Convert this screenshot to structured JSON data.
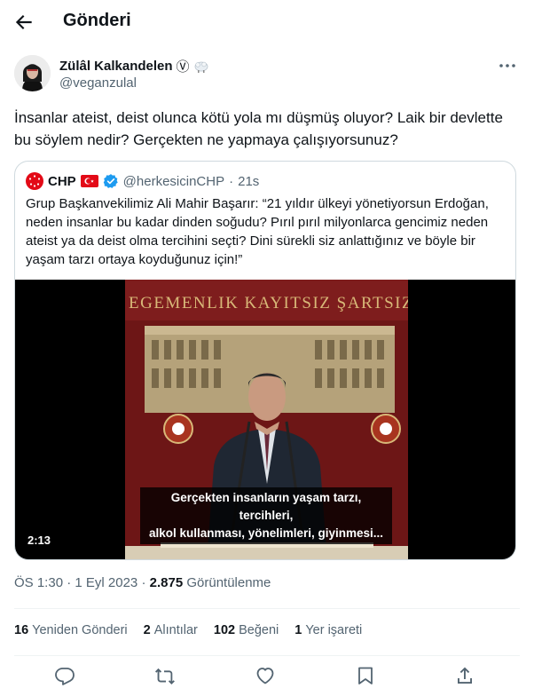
{
  "header": {
    "title": "Gönderi"
  },
  "author": {
    "name": "Zülâl Kalkandelen",
    "handle": "@veganzulal",
    "badge": "Ⓥ"
  },
  "tweet": {
    "text": "İnsanlar ateist, deist olunca kötü yola mı düşmüş oluyor? Laik bir devlette bu söylem nedir? Gerçekten ne yapmaya çalışıyorsunuz?"
  },
  "quote": {
    "name": "CHP",
    "handle": "@herkesicinCHP",
    "separator": "·",
    "time": "21s",
    "text": "Grup Başkanvekilimiz Ali Mahir Başarır: “21 yıldır ülkeyi yönetiyorsun Erdoğan, neden insanlar bu kadar dinden soğudu? Pırıl pırıl milyonlarca gencimiz neden ateist ya da deist olma tercihini seçti? Dini sürekli siz anlattığınız ve böyle bir yaşam tarzı ortaya koyduğunuz için!”",
    "video": {
      "banner": "EGEMENLIK KAYITSIZ ŞARTSIZ M",
      "subtitle_line1": "Gerçekten insanların yaşam tarzı, tercihleri,",
      "subtitle_line2": "alkol kullanması, yönelimleri, giyinmesi...",
      "duration": "2:13"
    }
  },
  "meta": {
    "time": "ÖS 1:30",
    "separator": "·",
    "date": "1 Eyl 2023",
    "separator2": "·",
    "views": "2.875",
    "views_label": "Görüntülenme"
  },
  "stats": {
    "retweets": "16",
    "retweets_label": "Yeniden Gönderi",
    "quotes": "2",
    "quotes_label": "Alıntılar",
    "likes": "102",
    "likes_label": "Beğeni",
    "bookmarks": "1",
    "bookmarks_label": "Yer işareti"
  },
  "icons": {
    "back": "arrow-left-icon",
    "more": "more-dots-icon",
    "reply": "reply-icon",
    "retweet": "retweet-icon",
    "like": "heart-icon",
    "bookmark": "bookmark-icon",
    "share": "share-icon"
  },
  "colors": {
    "verified": "#1d9bf0",
    "chp_red": "#e30a17",
    "text_secondary": "#536471",
    "border": "#cfd9de",
    "backdrop": "#7a1a1a"
  }
}
